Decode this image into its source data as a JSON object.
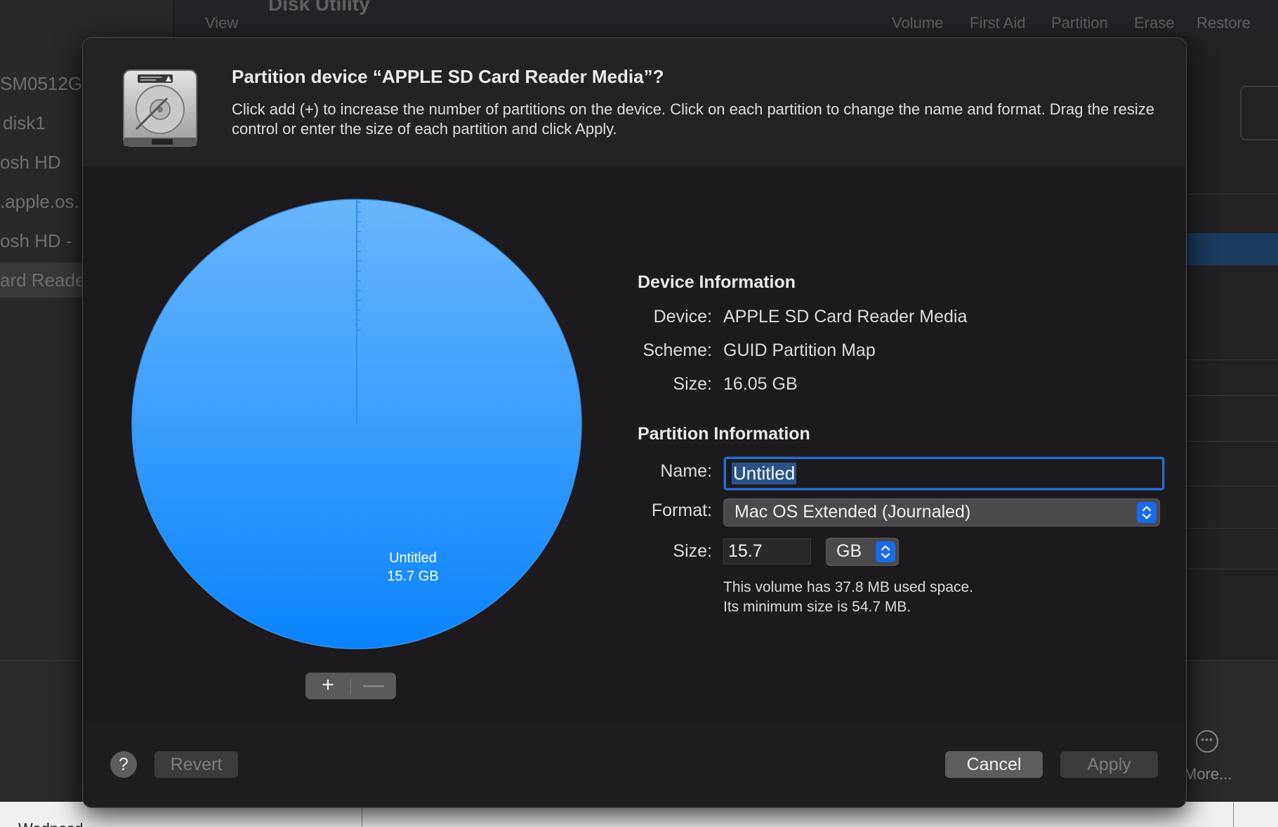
{
  "background": {
    "toolbar": {
      "view_label": "View",
      "app_title": "Disk Utility",
      "buttons": [
        "Volume",
        "First Aid",
        "Partition",
        "Erase",
        "Restore"
      ]
    },
    "sidebar_items": [
      "SM0512G",
      "disk1",
      "osh HD",
      ".apple.os.",
      "osh HD -",
      "ard Reade"
    ],
    "more_label": "More...",
    "strip_text": "Wednesd"
  },
  "dialog": {
    "title": "Partition device “APPLE SD Card Reader Media”?",
    "description": "Click add (+) to increase the number of partitions on the device. Click on each partition to change the name and format. Drag the resize control or enter the size of each partition and click Apply.",
    "icon": "hard-drive-icon",
    "pie": {
      "partition_name": "Untitled",
      "partition_size": "15.7 GB",
      "fill_fraction": 1.0,
      "color_top": "#6ab6fb",
      "color_bottom": "#0a84ff"
    },
    "add_label": "+",
    "remove_label": "—",
    "device_info": {
      "heading": "Device Information",
      "device_label": "Device:",
      "device_value": "APPLE SD Card Reader Media",
      "scheme_label": "Scheme:",
      "scheme_value": "GUID Partition Map",
      "size_label": "Size:",
      "size_value": "16.05 GB"
    },
    "partition_info": {
      "heading": "Partition Information",
      "name_label": "Name:",
      "name_value": "Untitled",
      "format_label": "Format:",
      "format_value": "Mac OS Extended (Journaled)",
      "size_label": "Size:",
      "size_value": "15.7",
      "size_unit": "GB",
      "note_line1": "This volume has 37.8 MB used space.",
      "note_line2": "Its minimum size is 54.7 MB."
    },
    "footer": {
      "help_label": "?",
      "revert_label": "Revert",
      "cancel_label": "Cancel",
      "apply_label": "Apply"
    },
    "accent_color": "#1a6bea"
  }
}
